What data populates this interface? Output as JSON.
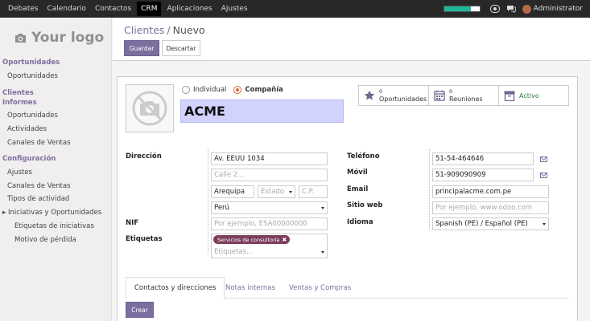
{
  "topbar": {
    "menu": [
      "Debates",
      "Calendario",
      "Contactos",
      "CRM",
      "Aplicaciones",
      "Ajustes"
    ],
    "active": "CRM",
    "progress_pct": 75,
    "user": "Administrator",
    "icons": [
      "progress-bar",
      "chat-icon",
      "messages-icon",
      "avatar"
    ]
  },
  "sidebar": {
    "logo_text": "Your logo",
    "sections": [
      {
        "header": "Oportunidades",
        "items": [
          "Oportunidades"
        ]
      },
      {
        "header": "Clientes",
        "items": []
      },
      {
        "header": "Informes",
        "items": [
          "Oportunidades",
          "Actividades",
          "Canales de Ventas"
        ]
      },
      {
        "header": "Configuración",
        "items": [
          "Ajustes",
          "Canales de Ventas",
          "Tipos de actividad",
          "Iniciativas y Oportunidades",
          "Etiquetas de iniciativas",
          "Motivo de pérdida"
        ]
      }
    ]
  },
  "control_panel": {
    "breadcrumb_parent": "Clientes",
    "breadcrumb_sep": "/",
    "breadcrumb_current": "Nuevo",
    "save_label": "Guardar",
    "discard_label": "Descartar"
  },
  "form": {
    "company_type": {
      "individual": "Individual",
      "company": "Compañía",
      "selected": "company"
    },
    "name": "ACME",
    "smart_buttons": [
      {
        "count": "0",
        "label": "Oportunidades",
        "icon": "star-icon"
      },
      {
        "count": "0",
        "label": "Reuniones",
        "icon": "calendar-icon"
      },
      {
        "count": "",
        "label": "Activo",
        "icon": "archive-icon"
      }
    ],
    "labels": {
      "address": "Dirección",
      "vat": "NIF",
      "tags": "Etiquetas",
      "phone": "Teléfono",
      "mobile": "Móvil",
      "email": "Email",
      "website": "Sitio web",
      "language": "Idioma"
    },
    "address": {
      "street": "Av. EEUU 1034",
      "street2_placeholder": "Calle 2...",
      "city": "Arequipa",
      "state_placeholder": "Estado",
      "zip_placeholder": "C.P.",
      "country": "Perú"
    },
    "vat_placeholder": "Por ejemplo, ESA00000000",
    "tags": {
      "values": [
        "Servicios de consultoría"
      ],
      "placeholder": "Etiquetas..."
    },
    "phone": "51-54-464646",
    "mobile": "51-909090909",
    "email": "principalacme.com.pe",
    "website_placeholder": "Por ejemplo, www.odoo.com",
    "language": "Spanish (PE) / Español (PE)"
  },
  "notebook": {
    "tabs": [
      "Contactos y direcciones",
      "Notas internas",
      "Ventas y Compras"
    ],
    "active_tab": 0,
    "create_label": "Crear"
  },
  "colors": {
    "primary": "#7c6f9f",
    "name_bg": "#d2d2ff",
    "tag": "#7c3f5b",
    "radio": "#e6633b",
    "topbar": "#282828"
  }
}
